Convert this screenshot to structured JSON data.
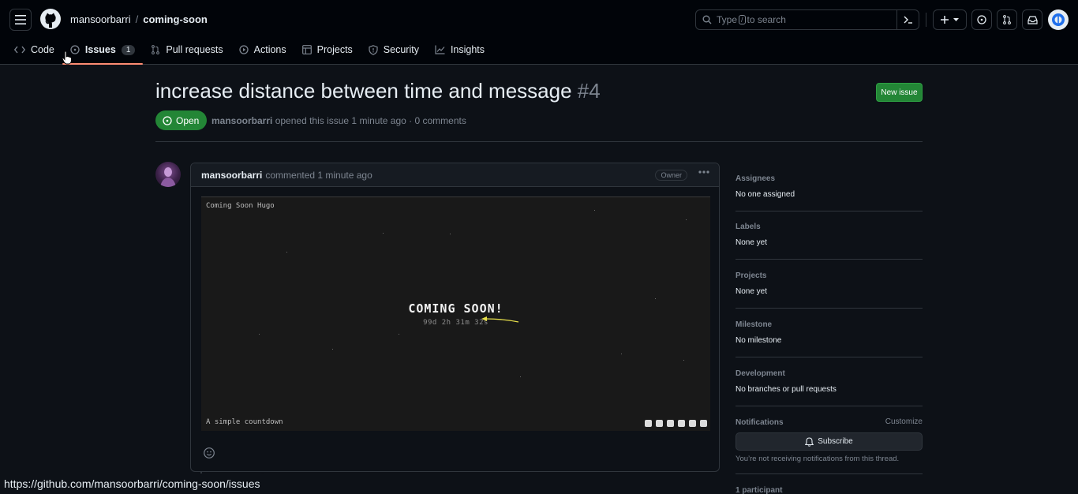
{
  "header": {
    "owner": "mansoorbarri",
    "separator": "/",
    "repo": "coming-soon",
    "search": {
      "prefix": "Type",
      "key": "/",
      "suffix": "to search"
    }
  },
  "tabs": [
    {
      "label": "Code",
      "icon": "code-icon"
    },
    {
      "label": "Issues",
      "icon": "issue-opened-icon",
      "count": "1",
      "selected": true
    },
    {
      "label": "Pull requests",
      "icon": "git-pull-request-icon"
    },
    {
      "label": "Actions",
      "icon": "play-icon"
    },
    {
      "label": "Projects",
      "icon": "table-icon"
    },
    {
      "label": "Security",
      "icon": "shield-icon"
    },
    {
      "label": "Insights",
      "icon": "graph-icon"
    }
  ],
  "issue": {
    "title": "increase distance between time and message",
    "number": "#4",
    "state": "Open",
    "new_issue_label": "New issue",
    "author": "mansoorbarri",
    "meta_text": "opened this issue 1 minute ago · 0 comments"
  },
  "comment": {
    "author": "mansoorbarri",
    "time_text": "commented 1 minute ago",
    "role": "Owner",
    "screenshot": {
      "brand": "Coming Soon Hugo",
      "headline": "COMING SOON!",
      "timer": "99d 2h 31m 32s",
      "tagline": "A simple countdown"
    }
  },
  "sidebar": {
    "assignees": {
      "label": "Assignees",
      "value": "No one assigned"
    },
    "labels": {
      "label": "Labels",
      "value": "None yet"
    },
    "projects": {
      "label": "Projects",
      "value": "None yet"
    },
    "milestone": {
      "label": "Milestone",
      "value": "No milestone"
    },
    "development": {
      "label": "Development",
      "value": "No branches or pull requests"
    },
    "notifications": {
      "label": "Notifications",
      "customize": "Customize",
      "subscribe": "Subscribe",
      "note": "You’re not receiving notifications from this thread."
    },
    "participants": {
      "label": "1 participant"
    }
  },
  "status_bar": {
    "url": "https://github.com/mansoorbarri/coming-soon/issues"
  },
  "colors": {
    "accent_green": "#238636",
    "tab_underline": "#fd8c73",
    "background": "#0d1117"
  }
}
